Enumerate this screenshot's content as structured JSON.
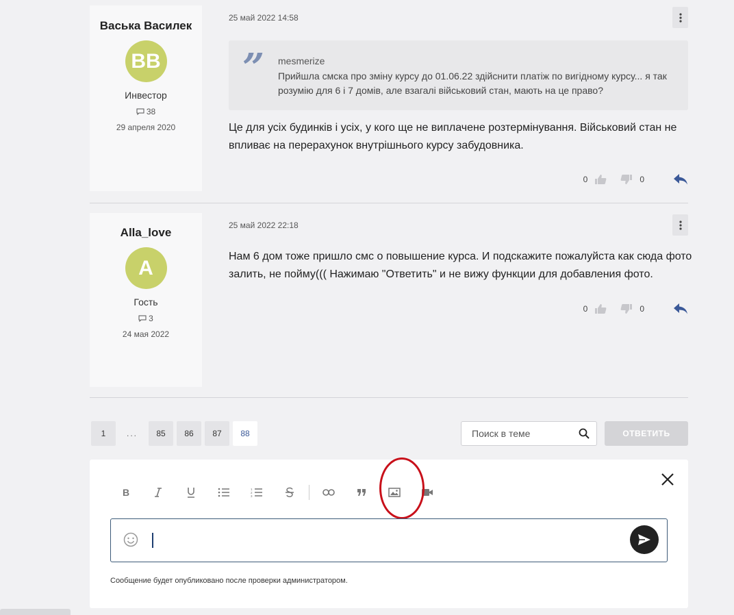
{
  "posts": [
    {
      "author": "Васька Василек",
      "initials": "ВВ",
      "role": "Инвестор",
      "message_count": "38",
      "joined": "29 апреля 2020",
      "date": "25 май 2022 14:58",
      "quote": {
        "author": "mesmerize",
        "text": "Прийшла смска про зміну курсу до 01.06.22 здійснити платіж по вигідному курсу... я так розумію для 6 і 7 домів, але взагалі військовий стан, мають на це право?"
      },
      "text": "Це для усіх будинків і усіх, у кого ще не виплачене розтермінування. Військовий стан не впливає на перерахунок внутрішнього курсу забудовника.",
      "likes": "0",
      "dislikes": "0"
    },
    {
      "author": "Alla_love",
      "initials": "A",
      "role": "Гость",
      "message_count": "3",
      "joined": "24 мая 2022",
      "date": "25 май 2022 22:18",
      "text": "Нам 6 дом тоже пришло смс о повышение курса. И подскажите пожалуйста как сюда фото залить, не пойму(((  Нажимаю \"Ответить\" и не вижу функции для добавления фото.",
      "likes": "0",
      "dislikes": "0"
    }
  ],
  "pagination": {
    "first": "1",
    "dots": "...",
    "pages": [
      "85",
      "86",
      "87"
    ],
    "current": "88"
  },
  "search": {
    "placeholder": "Поиск в теме"
  },
  "reply_button": "ОТВЕТИТЬ",
  "editor": {
    "toolbar": [
      "bold-icon",
      "italic-icon",
      "underline-icon",
      "bullet-list-icon",
      "numbered-list-icon",
      "strikethrough-icon",
      "link-icon",
      "quote-icon",
      "image-icon",
      "video-icon"
    ],
    "notice": "Сообщение будет опубликовано после проверки администратором."
  },
  "colors": {
    "avatar": "#c8d16a",
    "accent": "#3b5998",
    "highlight_circle": "#c8101a"
  }
}
